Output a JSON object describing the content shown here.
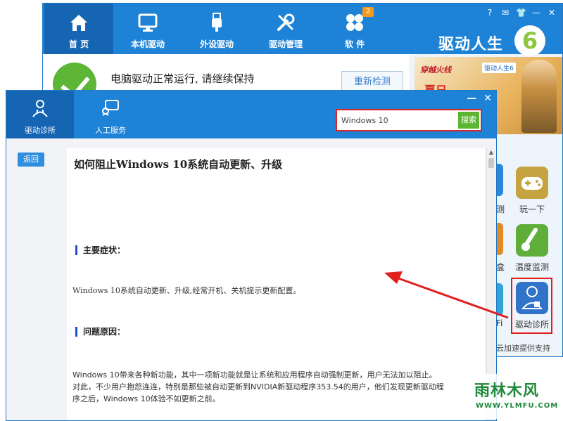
{
  "main_window": {
    "nav": [
      {
        "label": "首 页",
        "icon": "home-icon"
      },
      {
        "label": "本机驱动",
        "icon": "monitor-icon"
      },
      {
        "label": "外设驱动",
        "icon": "usb-icon"
      },
      {
        "label": "驱动管理",
        "icon": "tools-icon"
      },
      {
        "label": "软 件",
        "icon": "apps-icon",
        "badge": "2"
      }
    ],
    "title_controls": [
      "?",
      "✉",
      "👕",
      "—",
      "✕"
    ],
    "brand": "驱动人生",
    "status_text": "电脑驱动正常运行, 请继续保持",
    "recheck_label": "重新检测",
    "ad": {
      "game_title": "穿越火线",
      "logo_text": "驱动人生6",
      "headline": "夏日"
    },
    "tiles": [
      {
        "label": "玩一下",
        "icon": "gamepad-icon",
        "color": "#c6a341"
      },
      {
        "label": "温度监测",
        "icon": "thermometer-icon",
        "color": "#5fae3a"
      },
      {
        "label": "驱动诊所",
        "icon": "doctor-icon",
        "color": "#2f74c9"
      }
    ],
    "partial_labels": [
      "测",
      "盒",
      "Fi"
    ],
    "cloud_text": "云加速提供支持"
  },
  "dialog": {
    "tabs": [
      {
        "label": "驱动诊所",
        "icon": "doctor-icon"
      },
      {
        "label": "人工服务",
        "icon": "support-icon"
      }
    ],
    "controls": [
      "—",
      "✕"
    ],
    "search": {
      "value": "Windows 10",
      "button": "搜索"
    },
    "back_label": "返回",
    "article": {
      "title": "如何阻止Windows 10系统自动更新、升级",
      "section1": "主要症状：",
      "symptom": "Windows 10系统自动更新、升级,经常开机、关机提示更新配置。",
      "section2": "问题原因：",
      "cause_line1": "Windows 10带来各种新功能，其中一项新功能就是让系统和应用程序自动强制更新，用户无法加以阻止。",
      "cause_line2": "对此，不少用户抱怨连连，特别是那些被自动更新到NVIDIA新驱动程序353.54的用户，他们发现更新驱动程",
      "cause_line3": "序之后，Windows 10体验不如更新之前。"
    }
  },
  "watermark": {
    "main": "雨林木风",
    "sub": "WWW.YLMFU.COM"
  },
  "colors": {
    "header_blue": "#1e82d6",
    "active_blue": "#1565b3",
    "search_green": "#5bb532",
    "highlight_red": "#e02020"
  }
}
